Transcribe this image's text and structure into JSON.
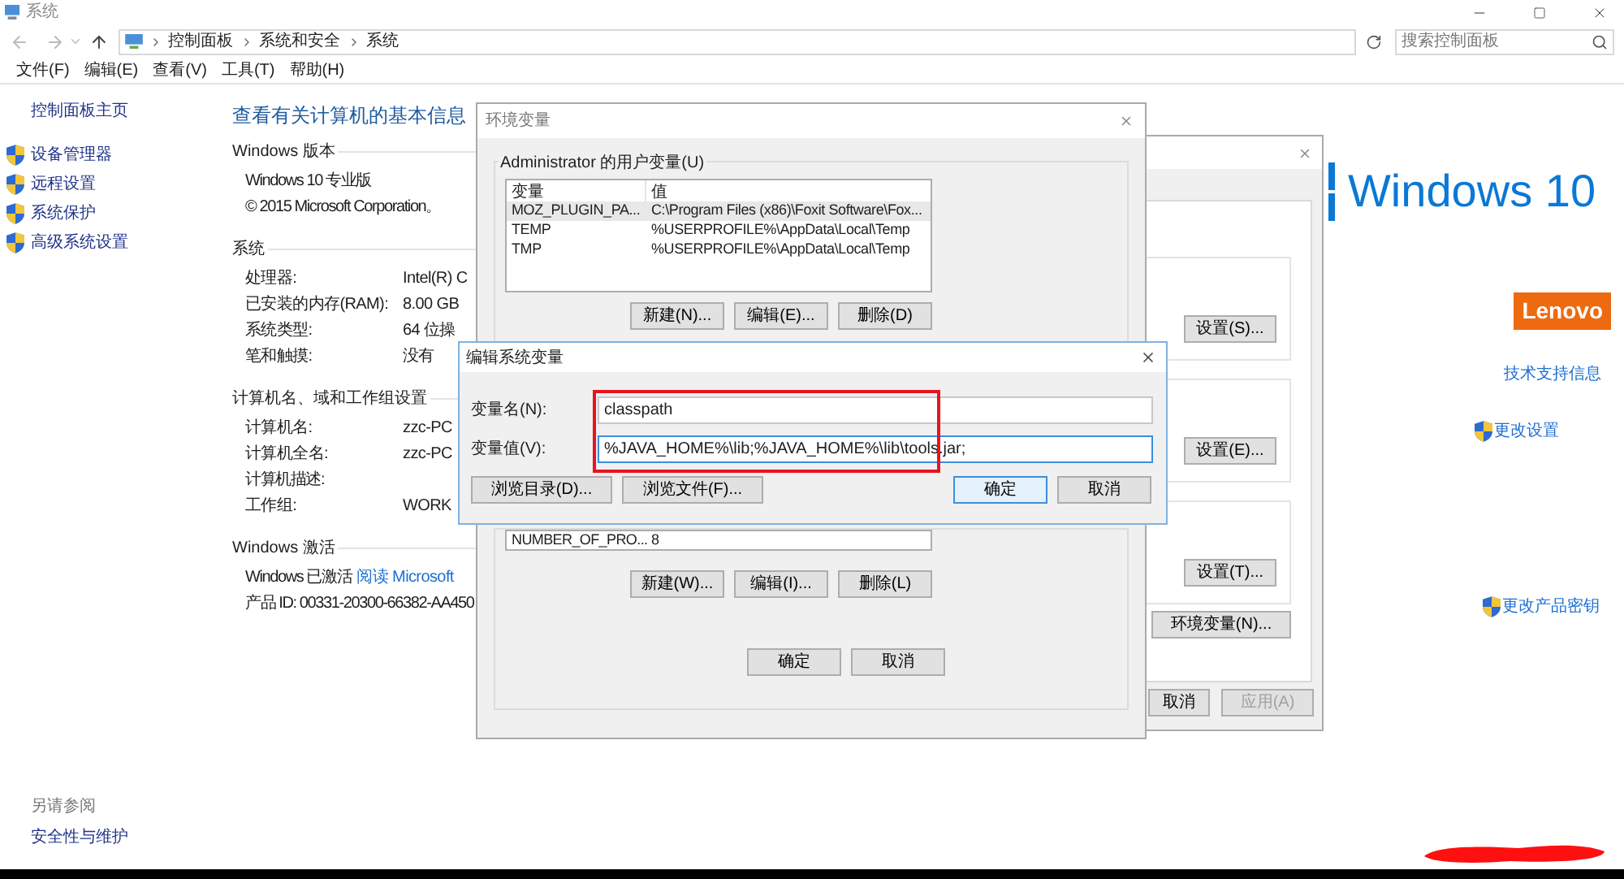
{
  "window": {
    "title": "系统",
    "breadcrumb": [
      "控制面板",
      "系统和安全",
      "系统"
    ],
    "search": {
      "placeholder": "搜索控制面板"
    }
  },
  "menu": [
    "文件(F)",
    "编辑(E)",
    "查看(V)",
    "工具(T)",
    "帮助(H)"
  ],
  "sidebar": {
    "home": "控制面板主页",
    "items": [
      "设备管理器",
      "远程设置",
      "系统保护",
      "高级系统设置"
    ],
    "see_also": {
      "heading": "另请参阅",
      "links": [
        "安全性与维护"
      ]
    }
  },
  "content": {
    "title": "查看有关计算机的基本信息",
    "sections": [
      {
        "heading": "Windows 版本",
        "rows": [
          {
            "label": "Windows 10 专业版"
          },
          {
            "label": "© 2015 Microsoft Corporation。"
          }
        ]
      },
      {
        "heading": "系统",
        "rows": [
          {
            "label": "处理器:",
            "value": "Intel(R) C"
          },
          {
            "label": "已安装的内存(RAM):",
            "value": "8.00 GB"
          },
          {
            "label": "系统类型:",
            "value": "64 位操"
          },
          {
            "label": "笔和触摸:",
            "value": "没有"
          }
        ]
      },
      {
        "heading": "计算机名、域和工作组设置",
        "rows": [
          {
            "label": "计算机名:",
            "value": "zzc-PC"
          },
          {
            "label": "计算机全名:",
            "value": "zzc-PC"
          },
          {
            "label": "计算机描述:"
          },
          {
            "label": "工作组:",
            "value": "WORK"
          }
        ]
      },
      {
        "heading": "Windows 激活",
        "rows": [
          {
            "label": "Windows 已激活",
            "link": "阅读 Microsoft"
          },
          {
            "label": "产品 ID: 00331-20300-66382-AA450"
          }
        ]
      }
    ]
  },
  "right_panel": {
    "logo": "Windows 10",
    "brand": "Lenovo",
    "support_link": "技术支持信息",
    "change_settings": "更改设置",
    "change_key": "更改产品密钥"
  },
  "system_properties": {
    "settings_buttons": [
      "设置(S)...",
      "设置(E)...",
      "设置(T)..."
    ],
    "env_button": "环境变量(N)...",
    "footer": [
      {
        "label": "取消",
        "disabled": false
      },
      {
        "label": "应用(A)",
        "disabled": true
      }
    ]
  },
  "env_vars": {
    "title": "环境变量",
    "user_group": "Administrator 的用户变量(U)",
    "columns": [
      "变量",
      "值"
    ],
    "rows": [
      {
        "name": "MOZ_PLUGIN_PA...",
        "value": "C:\\Program Files (x86)\\Foxit Software\\Fox...",
        "selected": true
      },
      {
        "name": "TEMP",
        "value": "%USERPROFILE%\\AppData\\Local\\Temp",
        "selected": false
      },
      {
        "name": "TMP",
        "value": "%USERPROFILE%\\AppData\\Local\\Temp",
        "selected": false
      }
    ],
    "user_buttons": [
      "新建(N)...",
      "编辑(E)...",
      "删除(D)"
    ],
    "system_row": {
      "name": "NUMBER_OF_PRO...",
      "value": "8"
    },
    "system_buttons": [
      "新建(W)...",
      "编辑(I)...",
      "删除(L)"
    ],
    "footer": [
      "确定",
      "取消"
    ]
  },
  "edit_dialog": {
    "title": "编辑系统变量",
    "fields": [
      {
        "label": "变量名(N):",
        "value": "classpath",
        "focused": false
      },
      {
        "label": "变量值(V):",
        "value": "%JAVA_HOME%\\lib;%JAVA_HOME%\\lib\\tools.jar;",
        "focused": true
      }
    ],
    "browse_buttons": [
      "浏览目录(D)...",
      "浏览文件(F)..."
    ],
    "buttons": [
      {
        "label": "确定",
        "default": true
      },
      {
        "label": "取消",
        "default": false
      }
    ]
  }
}
